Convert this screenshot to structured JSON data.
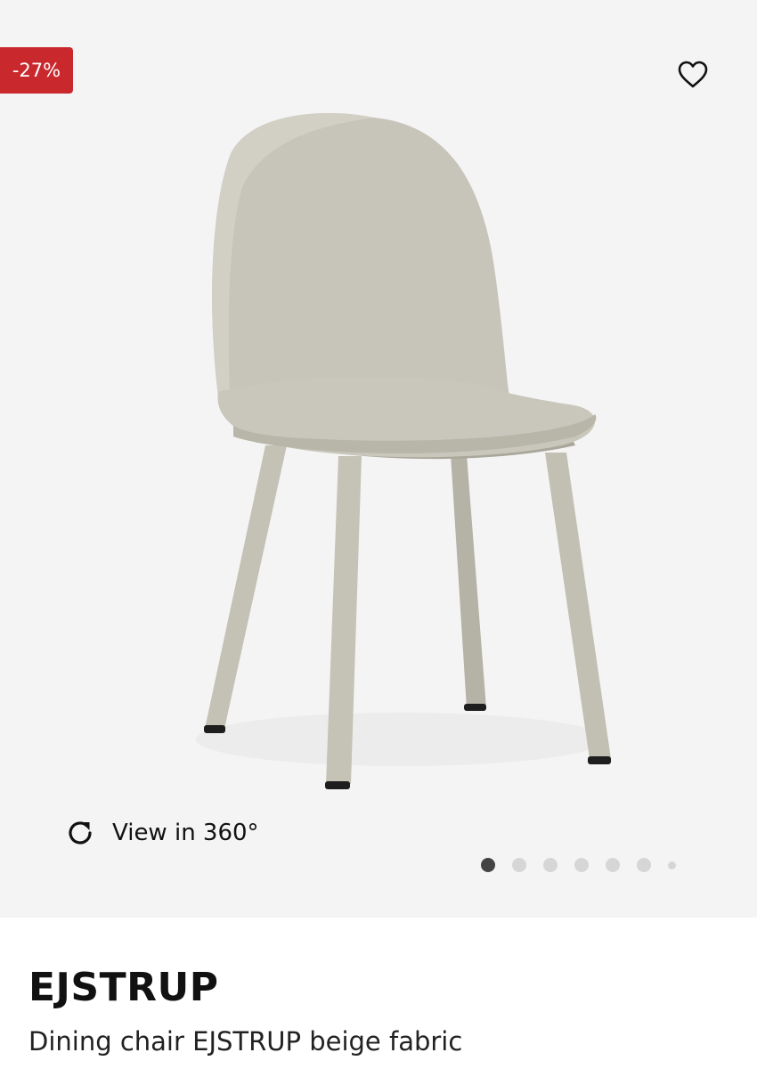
{
  "badge": {
    "discount": "-27%",
    "color": "#c9282d"
  },
  "favorite": {
    "icon": "heart-outline-icon"
  },
  "gallery": {
    "view360_label": "View in 360°",
    "view360_icon": "rotate-icon",
    "total_images": 7,
    "active_index": 0
  },
  "product": {
    "name": "EJSTRUP",
    "description": "Dining chair EJSTRUP beige fabric"
  }
}
